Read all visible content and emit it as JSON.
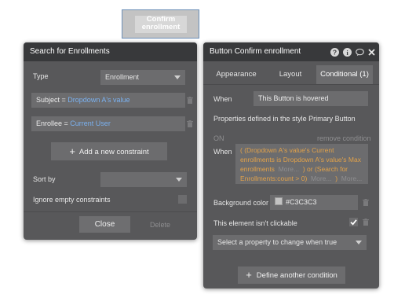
{
  "canvas_button": {
    "label": "Confirm enrollment"
  },
  "search_panel": {
    "title": "Search for Enrollments",
    "type_label": "Type",
    "type_value": "Enrollment",
    "constraints": [
      {
        "key": "Subject =",
        "value": "Dropdown A's value"
      },
      {
        "key": "Enrollee =",
        "value": "Current User"
      }
    ],
    "add_constraint_label": "Add a new constraint",
    "sort_by_label": "Sort by",
    "sort_by_value": "",
    "ignore_empty_label": "Ignore empty constraints",
    "close_label": "Close",
    "delete_label": "Delete"
  },
  "button_panel": {
    "title": "Button Confirm enrollment",
    "tabs": [
      {
        "label": "Appearance",
        "active": false
      },
      {
        "label": "Layout",
        "active": false
      },
      {
        "label": "Conditional (1)",
        "active": true
      }
    ],
    "when_label": "When",
    "when_value": "This Button is hovered",
    "properties_note": "Properties defined in the style Primary Button",
    "on_label": "ON",
    "remove_condition_label": "remove condition",
    "when2_label": "When",
    "expression": {
      "line1": "( (Dropdown A's value's Current",
      "line2": "enrollments is Dropdown A's value's Max",
      "line3a": "enrollments",
      "line3b": "More...",
      "line3c": ") or (Search for",
      "line4a": "Enrollments:count > 0)",
      "line4b": "More...",
      "line4c": ")",
      "line4d": "More..."
    },
    "bg_color_label": "Background color",
    "bg_color_value": "#C3C3C3",
    "not_clickable_label": "This element isn't clickable",
    "not_clickable_checked": true,
    "select_property_placeholder": "Select a property to change when true",
    "define_condition_label": "Define another condition"
  },
  "colors": {
    "panel_bg": "#58585a",
    "header_bg": "#38393b",
    "field_bg": "#6c6c6e",
    "accent_blue": "#7ab1f0",
    "expression_orange": "#e2a24a",
    "swatch": "#C3C3C3"
  },
  "icons": [
    "help-icon",
    "info-icon",
    "comment-icon",
    "close-icon",
    "trash-icon",
    "plus-icon",
    "checkmark-icon",
    "caret-down-icon"
  ]
}
